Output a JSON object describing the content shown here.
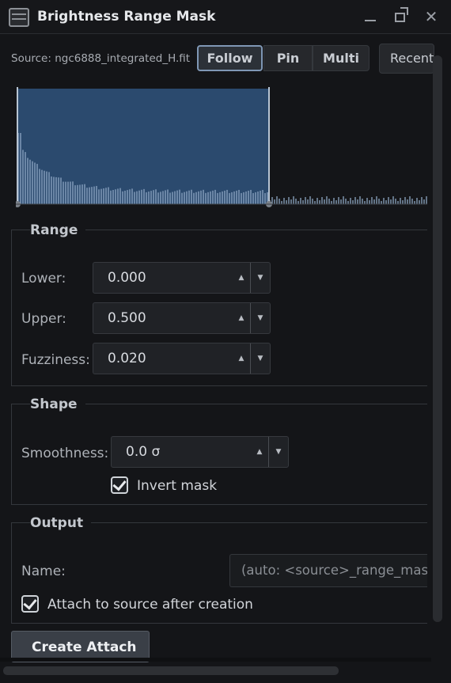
{
  "window": {
    "title": "Brightness Range Mask",
    "app_icon": "panel-icon",
    "controls": {
      "minimize": "minimize-icon",
      "float": "float-icon",
      "close": "close-icon",
      "close_glyph": "✕"
    }
  },
  "source": {
    "label": "Source: ngc6888_integrated_H.fit",
    "modes": [
      "Follow",
      "Pin",
      "Multi"
    ],
    "selected_mode": "Follow",
    "recent_label": "Recent"
  },
  "histogram": {
    "selection_lower": 0.0,
    "selection_upper": 0.5,
    "fill_color": "#2b4a6e",
    "bar_color": "#8ea7c4",
    "handle_color": "#7a8088"
  },
  "range": {
    "title": "Range",
    "fields": [
      {
        "label": "Lower:",
        "value": "0.000"
      },
      {
        "label": "Upper:",
        "value": "0.500"
      },
      {
        "label": "Fuzziness:",
        "value": "0.020"
      }
    ]
  },
  "shape": {
    "title": "Shape",
    "smoothness_label": "Smoothness:",
    "smoothness_value": "0.0 σ",
    "invert_label": "Invert mask",
    "invert_checked": true
  },
  "output": {
    "title": "Output",
    "name_label": "Name:",
    "name_placeholder": "(auto: <source>_range_mask)",
    "attach_label": "Attach to source after creation",
    "attach_checked": true
  },
  "actions": {
    "create_label": "Create  Attach"
  },
  "spin_glyphs": {
    "up": "▲",
    "down": "▼"
  }
}
